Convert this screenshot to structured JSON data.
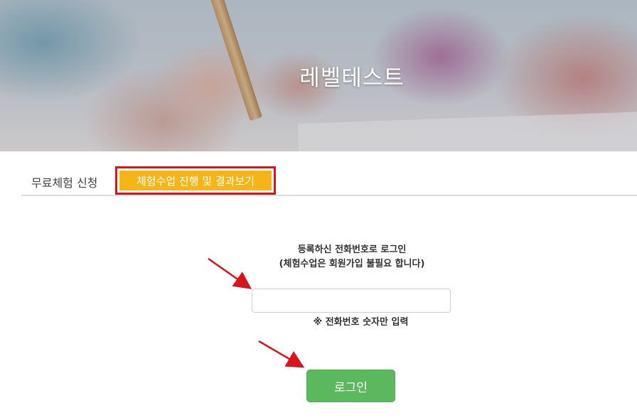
{
  "hero": {
    "title": "레벨테스트"
  },
  "tabs": [
    {
      "label": "무료체험 신청",
      "active": false
    },
    {
      "label": "체험수업 진행 및 결과보기",
      "active": true
    }
  ],
  "login": {
    "description_line1": "등록하신 전화번호로 로그인",
    "description_line2": "(체험수업은 회원가입 불필요 합니다)",
    "phone_input_value": "",
    "phone_note": "※ 전화번호 숫자만 입력",
    "button_label": "로그인"
  },
  "colors": {
    "active_tab_bg": "#f5b418",
    "highlight_border": "#d9141e",
    "login_button_bg": "#5cb85c",
    "annotation_arrow": "#d9141e"
  }
}
